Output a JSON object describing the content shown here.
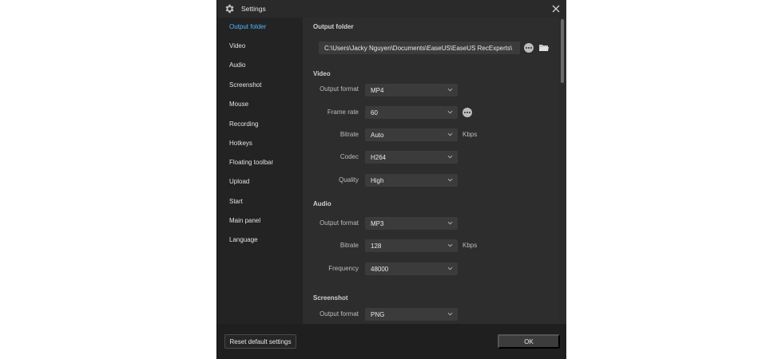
{
  "window": {
    "title": "Settings"
  },
  "sidebar": {
    "items": [
      {
        "label": "Output folder",
        "active": true
      },
      {
        "label": "Video"
      },
      {
        "label": "Audio"
      },
      {
        "label": "Screenshot"
      },
      {
        "label": "Mouse"
      },
      {
        "label": "Recording"
      },
      {
        "label": "Hotkeys"
      },
      {
        "label": "Floating toolbar"
      },
      {
        "label": "Upload"
      },
      {
        "label": "Start"
      },
      {
        "label": "Main panel"
      },
      {
        "label": "Language"
      }
    ]
  },
  "output_folder": {
    "title": "Output folder",
    "path": "C:\\Users\\Jacky Nguyen\\Documents\\EaseUS\\EaseUS RecExperts\\"
  },
  "video": {
    "title": "Video",
    "output_format": {
      "label": "Output format",
      "value": "MP4"
    },
    "frame_rate": {
      "label": "Frame rate",
      "value": "60"
    },
    "bitrate": {
      "label": "Bitrate",
      "value": "Auto",
      "unit": "Kbps"
    },
    "codec": {
      "label": "Codec",
      "value": "H264"
    },
    "quality": {
      "label": "Quality",
      "value": "High"
    }
  },
  "audio": {
    "title": "Audio",
    "output_format": {
      "label": "Output format",
      "value": "MP3"
    },
    "bitrate": {
      "label": "Bitrate",
      "value": "128",
      "unit": "Kbps"
    },
    "frequency": {
      "label": "Frequency",
      "value": "48000"
    }
  },
  "screenshot": {
    "title": "Screenshot",
    "output_format": {
      "label": "Output format",
      "value": "PNG"
    }
  },
  "footer": {
    "reset_label": "Reset default settings",
    "ok_label": "OK"
  },
  "colors": {
    "accent": "#4fb6ff",
    "background": "#232323",
    "panel": "#2d2d2d",
    "field": "#3b3b3b"
  }
}
